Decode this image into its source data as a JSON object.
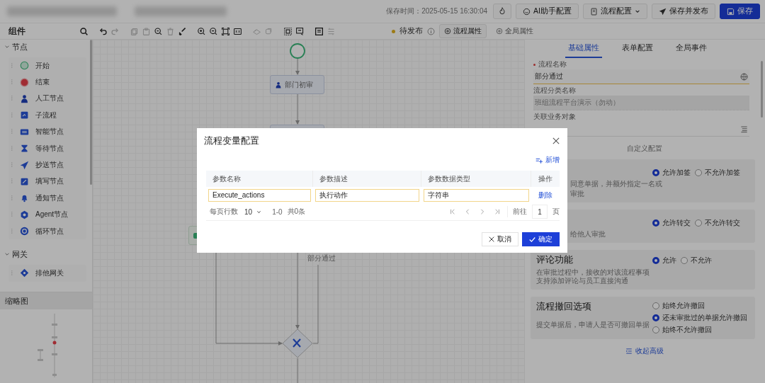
{
  "header": {
    "save_time": "保存时间：2025-05-15 16:30:04",
    "buttons": [
      {
        "kind": "icon"
      },
      {
        "kind": "ai",
        "label": "AI助手配置"
      },
      {
        "kind": "dropdown",
        "label": "流程配置"
      },
      {
        "kind": "publish",
        "label": "保存并发布"
      },
      {
        "kind": "primary",
        "label": "保存"
      }
    ]
  },
  "components_title": "组件",
  "toolbar": [
    [
      {
        "kind": "search",
        "disabled": false
      }
    ],
    [
      {
        "kind": "undo",
        "disabled": false
      },
      {
        "kind": "redo",
        "disabled": true
      }
    ],
    [
      {
        "kind": "copy",
        "disabled": true
      },
      {
        "kind": "paste",
        "disabled": true
      },
      {
        "kind": "find",
        "disabled": false
      },
      {
        "kind": "delete",
        "disabled": true
      },
      {
        "kind": "brush",
        "disabled": false
      }
    ],
    [
      {
        "kind": "zoom-in",
        "disabled": false
      },
      {
        "kind": "zoom-out",
        "disabled": false
      },
      {
        "kind": "fit",
        "disabled": false
      },
      {
        "kind": "actual",
        "disabled": false
      }
    ],
    [
      {
        "kind": "layers",
        "disabled": true
      },
      {
        "kind": "stack",
        "disabled": true
      }
    ],
    [
      {
        "kind": "select",
        "disabled": false
      },
      {
        "kind": "edit",
        "disabled": false
      }
    ],
    [
      {
        "kind": "frame",
        "disabled": false
      },
      {
        "kind": "grid",
        "disabled": true
      }
    ]
  ],
  "status": {
    "label": "待发布"
  },
  "process_tabs": [
    {
      "label": "流程属性",
      "selected": true
    },
    {
      "label": "全局属性",
      "selected": false
    }
  ],
  "sidebar": {
    "sections": [
      {
        "title": "节点",
        "expanded": true,
        "items": [
          {
            "kind": "start",
            "label": "开始"
          },
          {
            "kind": "end",
            "label": "结束"
          },
          {
            "kind": "user",
            "label": "人工节点"
          },
          {
            "kind": "subprocess",
            "label": "子流程"
          },
          {
            "kind": "smart",
            "label": "智能节点"
          },
          {
            "kind": "wait",
            "label": "等待节点"
          },
          {
            "kind": "cc",
            "label": "抄送节点"
          },
          {
            "kind": "fill",
            "label": "填写节点"
          },
          {
            "kind": "notify",
            "label": "通知节点"
          },
          {
            "kind": "agent",
            "label": "Agent节点"
          },
          {
            "kind": "loop",
            "label": "循环节点"
          }
        ]
      },
      {
        "title": "网关",
        "expanded": true,
        "items": [
          {
            "kind": "exclusive",
            "label": "排他网关"
          }
        ]
      }
    ]
  },
  "minimap": {
    "title": "缩略图"
  },
  "canvas": {
    "task_label": "部门初审",
    "edge_label": "部分通过"
  },
  "panel": {
    "tabs": [
      {
        "label": "基础属性",
        "selected": true
      },
      {
        "label": "表单配置",
        "selected": false
      },
      {
        "label": "全局事件",
        "selected": false
      }
    ],
    "fields": [
      {
        "kind": "translatable",
        "label": "流程名称",
        "required": true,
        "value": "部分通过",
        "disabled": false
      },
      {
        "kind": "text",
        "label": "流程分类名称",
        "required": false,
        "value": "班组流程平台演示（勿动）",
        "disabled": true
      },
      {
        "kind": "lookup",
        "label": "关联业务对象",
        "required": false,
        "disabled": false
      }
    ],
    "divider": "自定义配置",
    "cards": [
      {
        "kind": "inline",
        "desc": [
          "同意单据，并额外指定一名或",
          "审批"
        ],
        "options": [
          {
            "label": "允许加签",
            "selected": true
          },
          {
            "label": "不允许加签",
            "selected": false
          }
        ]
      },
      {
        "kind": "inline",
        "desc": [
          "给他人审批"
        ],
        "options": [
          {
            "label": "允许转交",
            "selected": true
          },
          {
            "label": "不允许转交",
            "selected": false
          }
        ]
      },
      {
        "kind": "inline",
        "title": "评论功能",
        "desc": [
          "在审批过程中，接收的对该流程事项支持添加评论与员工直接沟通"
        ],
        "options": [
          {
            "label": "允许",
            "selected": true
          },
          {
            "label": "不允许",
            "selected": false
          }
        ]
      },
      {
        "kind": "stacked",
        "title": "流程撤回选项",
        "desc": [
          "提交单据后，申请人是否可撤回单据"
        ],
        "options": [
          {
            "label": "始终允许撤回",
            "selected": false
          },
          {
            "label": "还未审批过的单据允许撤回",
            "selected": true
          },
          {
            "label": "始终不允许撤回",
            "selected": false
          }
        ]
      }
    ],
    "collapse": "收起高级"
  },
  "modal": {
    "title": "流程变量配置",
    "add": "新增",
    "columns": [
      "参数名称",
      "参数描述",
      "参数数据类型",
      "操作"
    ],
    "rows": [
      {
        "name": "Execute_actions",
        "description": "执行动作",
        "type": "字符串",
        "action": "删除"
      }
    ],
    "pagination": {
      "rows_label": "每页行数",
      "page_size": "10",
      "range": "1-0",
      "total": "共0条",
      "goto_label": "前往",
      "page": "1",
      "page_unit": "页"
    },
    "buttons": [
      {
        "kind": "cancel",
        "label": "取消"
      },
      {
        "kind": "confirm",
        "label": "确定"
      }
    ]
  }
}
